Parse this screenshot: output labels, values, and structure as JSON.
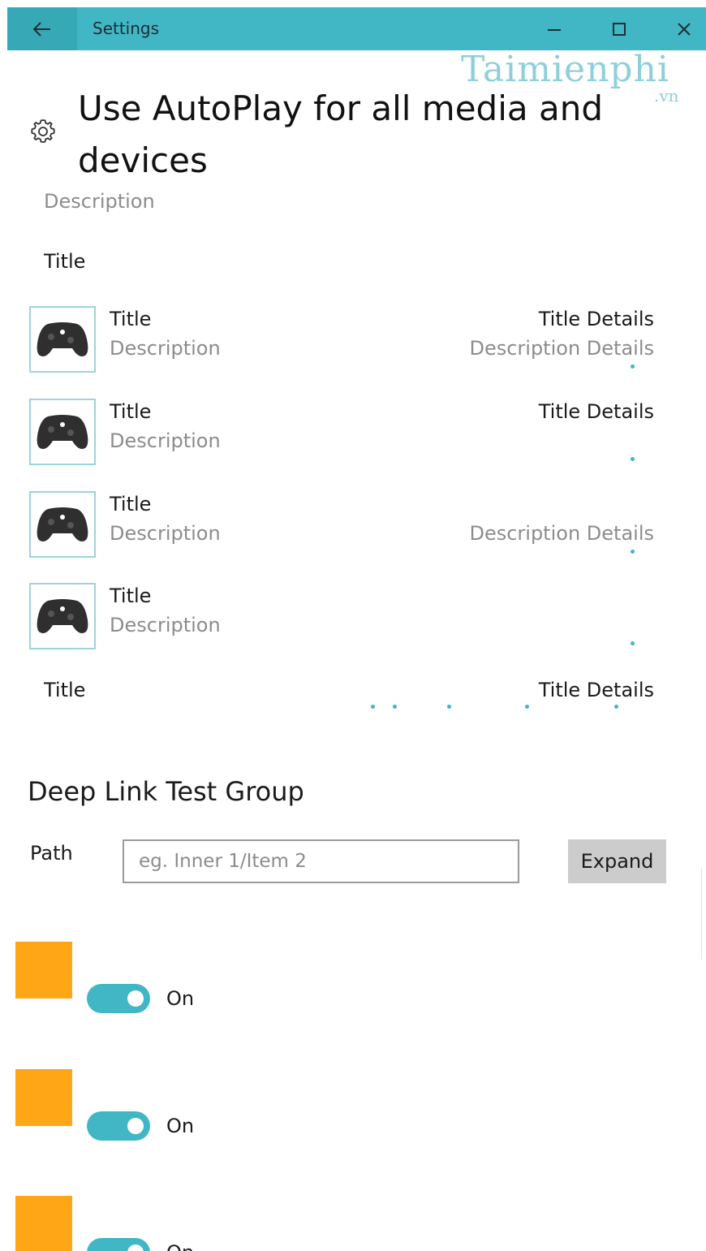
{
  "window": {
    "title": "Settings",
    "back_icon": "arrow-left-icon",
    "minimize_icon": "minimize-icon",
    "maximize_icon": "maximize-icon",
    "close_icon": "close-icon",
    "accent": "#41b6c4"
  },
  "watermark": {
    "text": "Taimienphi",
    "sub": ".vn"
  },
  "header": {
    "icon": "gear-icon",
    "title": "Use AutoPlay for all media and devices",
    "description": "Description"
  },
  "section1": {
    "title": "Title"
  },
  "items": [
    {
      "title": "Title",
      "description": "Description",
      "title_details": "Title Details",
      "description_details": "Description Details",
      "icon": "gamepad-icon"
    },
    {
      "title": "Title",
      "description": "Description",
      "title_details": "Title Details",
      "description_details": "",
      "icon": "gamepad-icon"
    },
    {
      "title": "Title",
      "description": "Description",
      "title_details": "",
      "description_details": "Description Details",
      "icon": "gamepad-icon"
    },
    {
      "title": "Title",
      "description": "Description",
      "title_details": "",
      "description_details": "",
      "icon": "gamepad-icon"
    }
  ],
  "section2": {
    "title": "Title",
    "title_details": "Title Details"
  },
  "deep_link": {
    "group_title": "Deep Link Test Group",
    "path_label": "Path",
    "path_placeholder": "eg. Inner 1/Item 2",
    "path_value": "",
    "expand_label": "Expand"
  },
  "toggles": [
    {
      "state_label": "On",
      "on": true,
      "swatch_color": "#ffa616"
    },
    {
      "state_label": "On",
      "on": true,
      "swatch_color": "#ffa616"
    },
    {
      "state_label": "On",
      "on": true,
      "swatch_color": "#ffa616"
    }
  ]
}
